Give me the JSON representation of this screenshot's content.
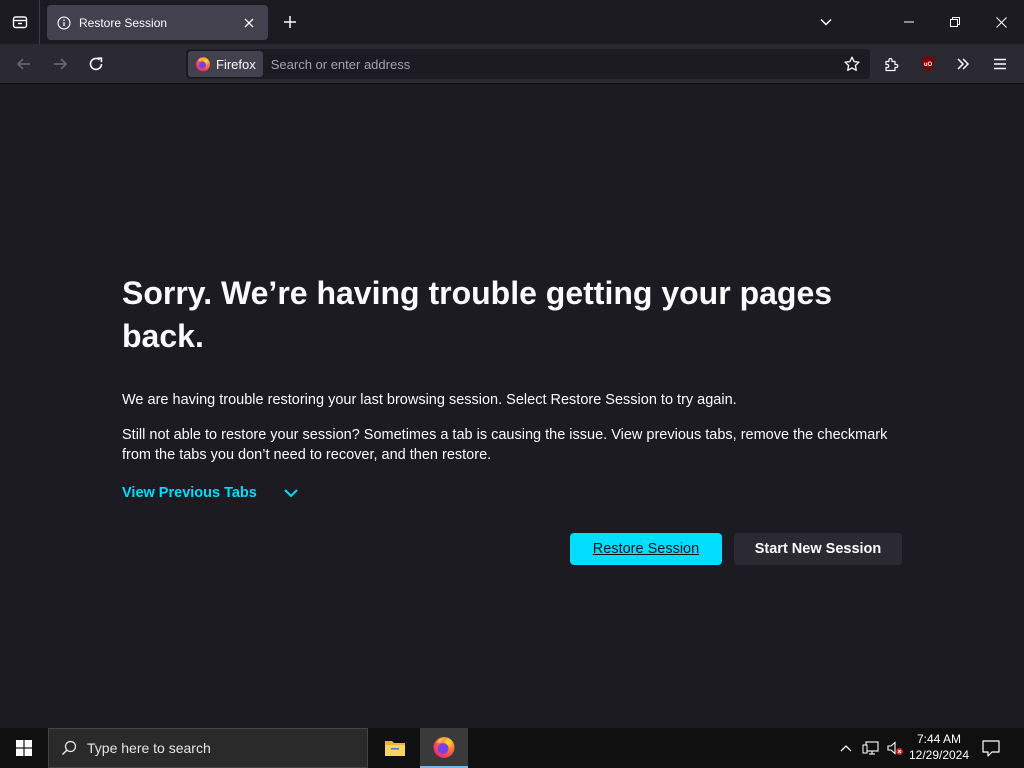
{
  "tab": {
    "title": "Restore Session"
  },
  "urlbar": {
    "identity_label": "Firefox",
    "placeholder": "Search or enter address"
  },
  "content": {
    "title": "Sorry. We’re having trouble getting your pages back.",
    "paragraph1": "We are having trouble restoring your last browsing session. Select Restore Session to try again.",
    "paragraph2": "Still not able to restore your session? Sometimes a tab is causing the issue. View previous tabs, remove the checkmark from the tabs you don’t need to recover, and then restore.",
    "view_previous_tabs": "View Previous Tabs",
    "restore_button": "Restore Session",
    "new_session_button": "Start New Session"
  },
  "taskbar": {
    "search_placeholder": "Type here to search",
    "time": "7:44 AM",
    "date": "12/29/2024"
  },
  "colors": {
    "accent": "#00ddff",
    "page_bg": "#1c1b22",
    "toolbar_bg": "#2b2a33",
    "tab_selected_bg": "#42414d"
  },
  "icons": [
    "list-all-tabs-icon",
    "info-icon",
    "close-icon",
    "plus-icon",
    "chevron-down-icon",
    "minimize-icon",
    "restore-icon",
    "back-arrow-icon",
    "forward-arrow-icon",
    "reload-icon",
    "firefox-logo-icon",
    "star-icon",
    "puzzle-icon",
    "ublock-icon",
    "double-chevron-icon",
    "hamburger-menu-icon",
    "windows-logo-icon",
    "search-icon",
    "folder-icon",
    "network-icon",
    "volume-muted-icon",
    "notification-icon"
  ]
}
